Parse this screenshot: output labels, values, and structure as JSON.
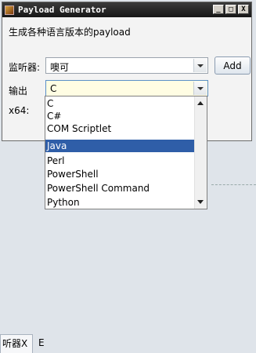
{
  "window": {
    "title": "Payload Generator",
    "subtitle": "生成各种语言版本的payload",
    "controls": {
      "minimize": "_",
      "maximize": "□",
      "close": "X"
    }
  },
  "listener": {
    "label": "监听器:",
    "value": "噢可",
    "add_label": "Add"
  },
  "output": {
    "label": "输出",
    "value": "C"
  },
  "x64": {
    "label": "x64:"
  },
  "dropdown": {
    "options": [
      "C",
      "C#",
      "COM Scriptlet",
      "Java",
      "Perl",
      "PowerShell",
      "PowerShell Command",
      "Python"
    ],
    "highlighted": "Java"
  },
  "background_tabs": {
    "tab1": "听器X",
    "tab2": "E"
  },
  "colors": {
    "titlebar": "#161616",
    "selection": "#2f5ea8",
    "focused_field": "#fffde3"
  }
}
